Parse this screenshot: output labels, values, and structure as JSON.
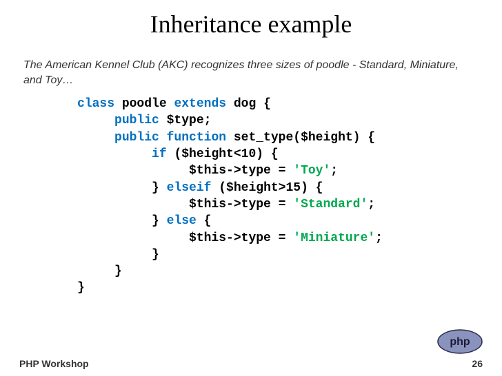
{
  "title": "Inheritance example",
  "intro": "The American Kennel Club (AKC) recognizes three sizes of poodle -  Standard, Miniature, and Toy…",
  "code": {
    "kw_class": "class",
    "classname": " poodle ",
    "kw_extends": "extends",
    "superclass": " dog {",
    "kw_public1": "public",
    "prop": " $type;",
    "kw_public2": "public",
    "kw_function": " function",
    "funcname": " set_type($height) {",
    "kw_if": "if",
    "cond_if": " ($height<10) {",
    "assign_toy_pre": "$this->type = ",
    "str_toy": "'Toy'",
    "semi1": ";",
    "brace1": "} ",
    "kw_elseif": "elseif",
    "cond_elseif": " ($height>15) {",
    "assign_std_pre": "$this->type = ",
    "str_std": "'Standard'",
    "semi2": ";",
    "brace2": "} ",
    "kw_else": "else",
    "else_brace": " {",
    "assign_min_pre": "$this->type = ",
    "str_min": "'Miniature'",
    "semi3": ";",
    "brace3": "}",
    "brace4": "}",
    "brace5": "}"
  },
  "footer": {
    "left": "PHP Workshop",
    "page": "26",
    "logo_text": "php"
  }
}
